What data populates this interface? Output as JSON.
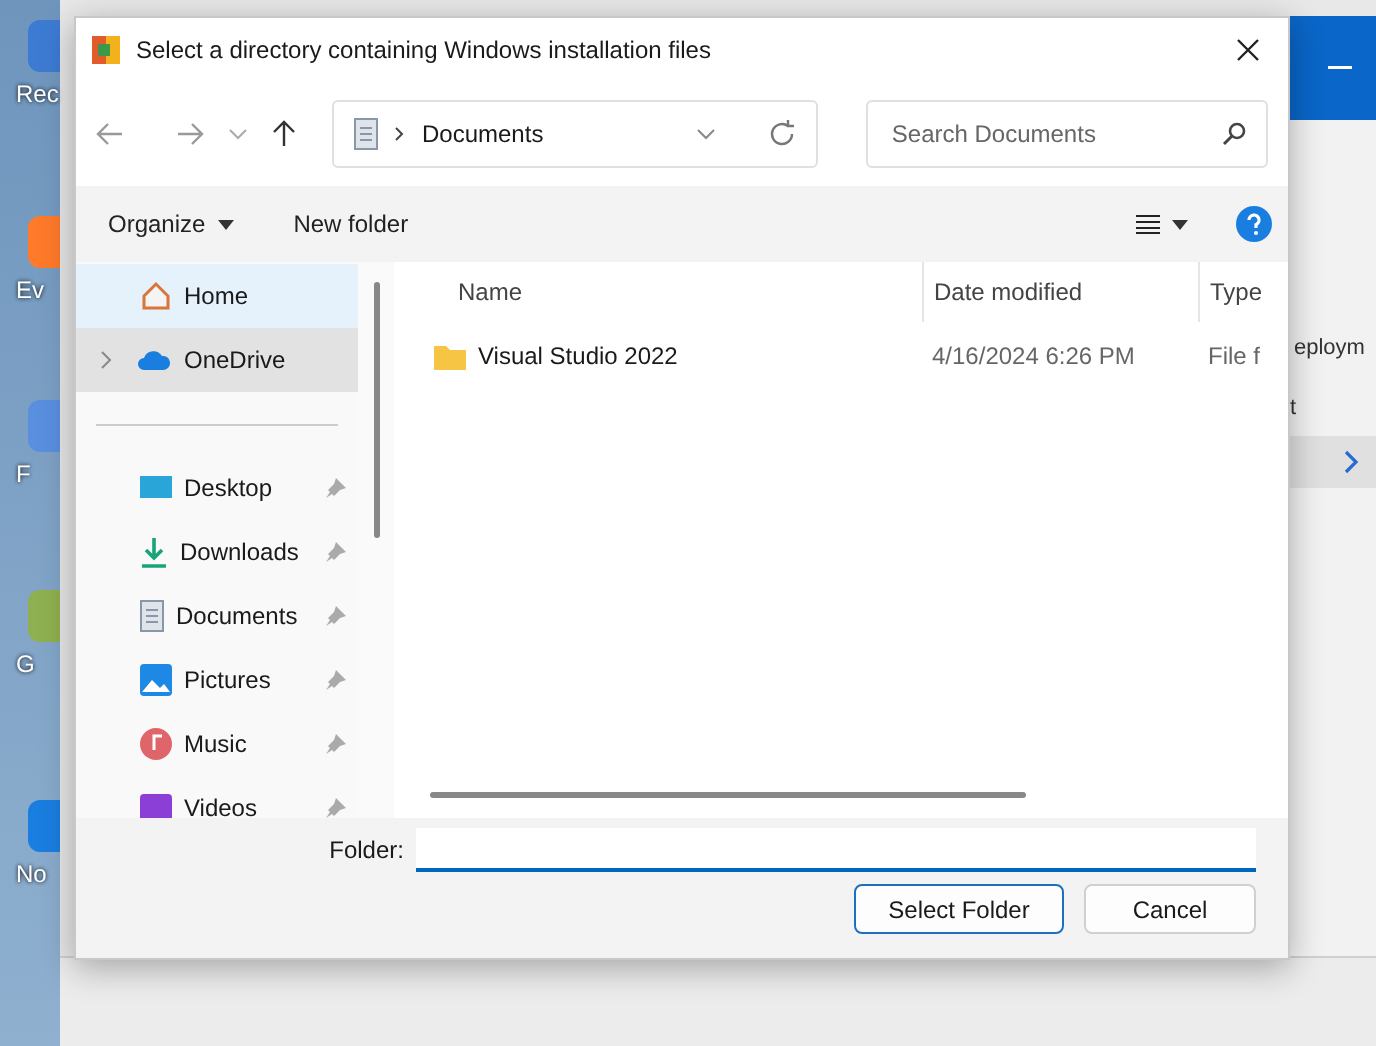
{
  "desktop_labels": [
    "Rec",
    "Ev",
    "F",
    "G",
    "No"
  ],
  "background_window": {
    "texts": [
      "eploym",
      "t"
    ]
  },
  "dialog": {
    "title": "Select a directory containing Windows installation files",
    "breadcrumb": "Documents",
    "search": {
      "placeholder": "Search Documents"
    },
    "commands": {
      "organize": "Organize",
      "new_folder": "New folder"
    },
    "sidebar": [
      {
        "label": "Home",
        "kind": "home",
        "selected": false,
        "hovered": true,
        "expandable": false,
        "pinned": false
      },
      {
        "label": "OneDrive",
        "kind": "cloud",
        "selected": true,
        "hovered": false,
        "expandable": true,
        "pinned": false
      },
      {
        "kind": "separator"
      },
      {
        "label": "Desktop",
        "kind": "desktop",
        "selected": false,
        "hovered": false,
        "expandable": false,
        "pinned": true
      },
      {
        "label": "Downloads",
        "kind": "download",
        "selected": false,
        "hovered": false,
        "expandable": false,
        "pinned": true
      },
      {
        "label": "Documents",
        "kind": "document",
        "selected": false,
        "hovered": false,
        "expandable": false,
        "pinned": true
      },
      {
        "label": "Pictures",
        "kind": "picture",
        "selected": false,
        "hovered": false,
        "expandable": false,
        "pinned": true
      },
      {
        "label": "Music",
        "kind": "music",
        "selected": false,
        "hovered": false,
        "expandable": false,
        "pinned": true
      },
      {
        "label": "Videos",
        "kind": "video",
        "selected": false,
        "hovered": false,
        "expandable": false,
        "pinned": true
      }
    ],
    "columns": [
      "Name",
      "Date modified",
      "Type"
    ],
    "rows": [
      {
        "name": "Visual Studio 2022",
        "date": "4/16/2024 6:26 PM",
        "type": "File f",
        "selected": false
      }
    ],
    "folder": {
      "label": "Folder:"
    },
    "buttons": [
      {
        "label": "Select Folder",
        "primary": true
      },
      {
        "label": "Cancel",
        "primary": false
      }
    ]
  }
}
